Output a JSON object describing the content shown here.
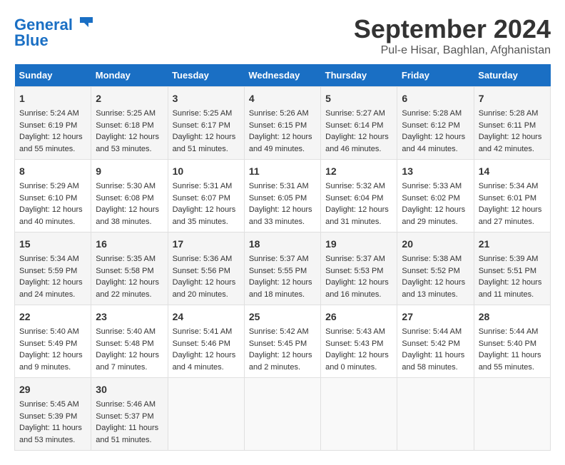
{
  "header": {
    "logo_line1": "General",
    "logo_line2": "Blue",
    "title": "September 2024",
    "subtitle": "Pul-e Hisar, Baghlan, Afghanistan"
  },
  "calendar": {
    "days_of_week": [
      "Sunday",
      "Monday",
      "Tuesday",
      "Wednesday",
      "Thursday",
      "Friday",
      "Saturday"
    ],
    "weeks": [
      [
        null,
        null,
        null,
        null,
        null,
        null,
        null
      ]
    ],
    "cells": [
      {
        "day": null,
        "content": ""
      },
      {
        "day": null,
        "content": ""
      },
      {
        "day": null,
        "content": ""
      },
      {
        "day": null,
        "content": ""
      },
      {
        "day": null,
        "content": ""
      },
      {
        "day": null,
        "content": ""
      },
      {
        "day": null,
        "content": ""
      },
      {
        "day": 1,
        "content": "Sunrise: 5:24 AM\nSunset: 6:19 PM\nDaylight: 12 hours\nand 55 minutes."
      },
      {
        "day": 2,
        "content": "Sunrise: 5:25 AM\nSunset: 6:18 PM\nDaylight: 12 hours\nand 53 minutes."
      },
      {
        "day": 3,
        "content": "Sunrise: 5:25 AM\nSunset: 6:17 PM\nDaylight: 12 hours\nand 51 minutes."
      },
      {
        "day": 4,
        "content": "Sunrise: 5:26 AM\nSunset: 6:15 PM\nDaylight: 12 hours\nand 49 minutes."
      },
      {
        "day": 5,
        "content": "Sunrise: 5:27 AM\nSunset: 6:14 PM\nDaylight: 12 hours\nand 46 minutes."
      },
      {
        "day": 6,
        "content": "Sunrise: 5:28 AM\nSunset: 6:12 PM\nDaylight: 12 hours\nand 44 minutes."
      },
      {
        "day": 7,
        "content": "Sunrise: 5:28 AM\nSunset: 6:11 PM\nDaylight: 12 hours\nand 42 minutes."
      },
      {
        "day": 8,
        "content": "Sunrise: 5:29 AM\nSunset: 6:10 PM\nDaylight: 12 hours\nand 40 minutes."
      },
      {
        "day": 9,
        "content": "Sunrise: 5:30 AM\nSunset: 6:08 PM\nDaylight: 12 hours\nand 38 minutes."
      },
      {
        "day": 10,
        "content": "Sunrise: 5:31 AM\nSunset: 6:07 PM\nDaylight: 12 hours\nand 35 minutes."
      },
      {
        "day": 11,
        "content": "Sunrise: 5:31 AM\nSunset: 6:05 PM\nDaylight: 12 hours\nand 33 minutes."
      },
      {
        "day": 12,
        "content": "Sunrise: 5:32 AM\nSunset: 6:04 PM\nDaylight: 12 hours\nand 31 minutes."
      },
      {
        "day": 13,
        "content": "Sunrise: 5:33 AM\nSunset: 6:02 PM\nDaylight: 12 hours\nand 29 minutes."
      },
      {
        "day": 14,
        "content": "Sunrise: 5:34 AM\nSunset: 6:01 PM\nDaylight: 12 hours\nand 27 minutes."
      },
      {
        "day": 15,
        "content": "Sunrise: 5:34 AM\nSunset: 5:59 PM\nDaylight: 12 hours\nand 24 minutes."
      },
      {
        "day": 16,
        "content": "Sunrise: 5:35 AM\nSunset: 5:58 PM\nDaylight: 12 hours\nand 22 minutes."
      },
      {
        "day": 17,
        "content": "Sunrise: 5:36 AM\nSunset: 5:56 PM\nDaylight: 12 hours\nand 20 minutes."
      },
      {
        "day": 18,
        "content": "Sunrise: 5:37 AM\nSunset: 5:55 PM\nDaylight: 12 hours\nand 18 minutes."
      },
      {
        "day": 19,
        "content": "Sunrise: 5:37 AM\nSunset: 5:53 PM\nDaylight: 12 hours\nand 16 minutes."
      },
      {
        "day": 20,
        "content": "Sunrise: 5:38 AM\nSunset: 5:52 PM\nDaylight: 12 hours\nand 13 minutes."
      },
      {
        "day": 21,
        "content": "Sunrise: 5:39 AM\nSunset: 5:51 PM\nDaylight: 12 hours\nand 11 minutes."
      },
      {
        "day": 22,
        "content": "Sunrise: 5:40 AM\nSunset: 5:49 PM\nDaylight: 12 hours\nand 9 minutes."
      },
      {
        "day": 23,
        "content": "Sunrise: 5:40 AM\nSunset: 5:48 PM\nDaylight: 12 hours\nand 7 minutes."
      },
      {
        "day": 24,
        "content": "Sunrise: 5:41 AM\nSunset: 5:46 PM\nDaylight: 12 hours\nand 4 minutes."
      },
      {
        "day": 25,
        "content": "Sunrise: 5:42 AM\nSunset: 5:45 PM\nDaylight: 12 hours\nand 2 minutes."
      },
      {
        "day": 26,
        "content": "Sunrise: 5:43 AM\nSunset: 5:43 PM\nDaylight: 12 hours\nand 0 minutes."
      },
      {
        "day": 27,
        "content": "Sunrise: 5:44 AM\nSunset: 5:42 PM\nDaylight: 11 hours\nand 58 minutes."
      },
      {
        "day": 28,
        "content": "Sunrise: 5:44 AM\nSunset: 5:40 PM\nDaylight: 11 hours\nand 55 minutes."
      },
      {
        "day": 29,
        "content": "Sunrise: 5:45 AM\nSunset: 5:39 PM\nDaylight: 11 hours\nand 53 minutes."
      },
      {
        "day": 30,
        "content": "Sunrise: 5:46 AM\nSunset: 5:37 PM\nDaylight: 11 hours\nand 51 minutes."
      },
      {
        "day": null,
        "content": ""
      },
      {
        "day": null,
        "content": ""
      },
      {
        "day": null,
        "content": ""
      },
      {
        "day": null,
        "content": ""
      },
      {
        "day": null,
        "content": ""
      }
    ]
  }
}
